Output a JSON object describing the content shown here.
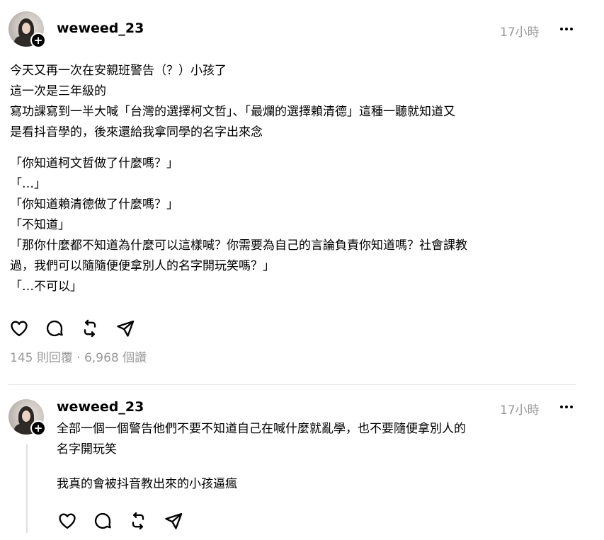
{
  "post": {
    "username": "weweed_23",
    "timestamp": "17小時",
    "follow_symbol": "+",
    "body_lines_1": [
      "今天又再一次在安親班警告（？）小孩了",
      "這一次是三年級的",
      "寫功課寫到一半大喊「台灣的選擇柯文哲」、「最爛的選擇賴清德」這種一聽就知道又",
      "是看抖音學的，後來還給我拿同學的名字出來念"
    ],
    "body_lines_2": [
      "「你知道柯文哲做了什麼嗎？」",
      "「…」",
      "「你知道賴清德做了什麼嗎？」",
      "「不知道」",
      "「那你什麼都不知道為什麼可以這樣喊？你需要為自己的言論負責你知道嗎？社會課教",
      "過，我們可以隨隨便便拿別人的名字開玩笑嗎？」",
      "「…不可以」"
    ],
    "meta": "145 則回覆 · 6,968 個讚"
  },
  "reply": {
    "username": "weweed_23",
    "timestamp": "17小時",
    "follow_symbol": "+",
    "body_lines_1": [
      "全部一個一個警告他們不要不知道自己在喊什麼就亂學，也不要隨便拿別人的",
      "名字開玩笑"
    ],
    "body_lines_2": [
      "我真的會被抖音教出來的小孩逼瘋"
    ]
  },
  "icons": {
    "like": "heart-icon",
    "comment": "comment-icon",
    "repost": "repost-icon",
    "share": "send-icon",
    "more": "more-icon"
  },
  "colors": {
    "text": "#000000",
    "muted": "#999999",
    "divider": "#e5e5e5"
  }
}
